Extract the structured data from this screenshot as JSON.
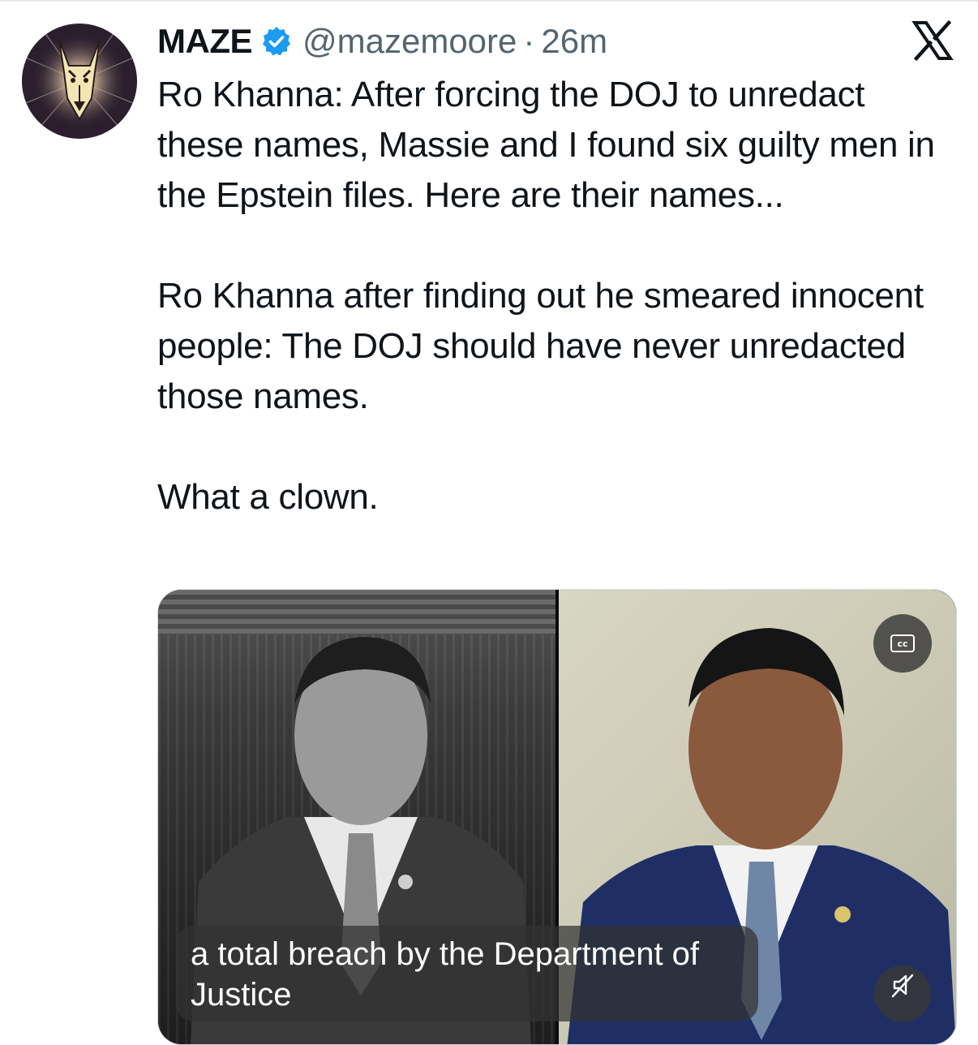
{
  "tweet": {
    "author_name": "MAZE",
    "handle": "@mazemoore",
    "separator": "·",
    "time": "26m",
    "paragraphs": [
      "Ro Khanna: After forcing the DOJ to unredact these names, Massie and I found six guilty men in the Epstein files. Here are their names...",
      "Ro Khanna after finding out he smeared innocent people: The DOJ should have never unredacted those names.",
      "What a clown."
    ]
  },
  "media": {
    "cc_label": "cc",
    "caption_line1": "a total breach by the Department of",
    "caption_line2": "Justice"
  },
  "icons": {
    "verified": "verified-badge-icon",
    "platform": "x-logo-icon",
    "captions": "closed-captions-icon",
    "mute": "muted-speaker-icon"
  },
  "colors": {
    "verified_blue": "#1d9bf0",
    "text_primary": "#0f1419",
    "text_secondary": "#536471"
  }
}
